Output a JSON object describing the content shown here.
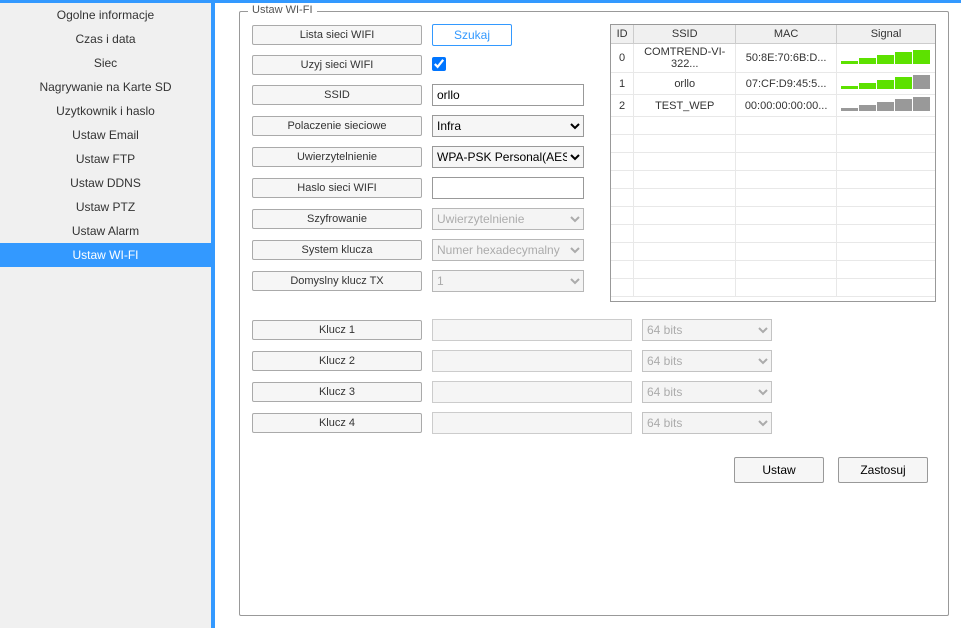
{
  "sidebar": {
    "items": [
      {
        "label": "Ogolne informacje"
      },
      {
        "label": "Czas i data"
      },
      {
        "label": "Siec"
      },
      {
        "label": "Nagrywanie na Karte SD"
      },
      {
        "label": "Uzytkownik i haslo"
      },
      {
        "label": "Ustaw Email"
      },
      {
        "label": "Ustaw FTP"
      },
      {
        "label": "Ustaw DDNS"
      },
      {
        "label": "Ustaw PTZ"
      },
      {
        "label": "Ustaw Alarm"
      },
      {
        "label": "Ustaw WI-FI"
      }
    ],
    "active_index": 10
  },
  "panel": {
    "title": "Ustaw WI-FI"
  },
  "form": {
    "lista_label": "Lista sieci WIFI",
    "szukaj_label": "Szukaj",
    "uzyj_label": "Uzyj sieci WIFI",
    "uzyj_checked": true,
    "ssid_label": "SSID",
    "ssid_value": "orllo",
    "polaczenie_label": "Polaczenie sieciowe",
    "polaczenie_value": "Infra",
    "uwierzytelnienie_label": "Uwierzytelnienie",
    "uwierzytelnienie_value": "WPA-PSK Personal(AES)",
    "haslo_label": "Haslo sieci WIFI",
    "haslo_value": "",
    "szyfrowanie_label": "Szyfrowanie",
    "szyfrowanie_value": "Uwierzytelnienie",
    "system_klucza_label": "System klucza",
    "system_klucza_value": "Numer hexadecymalny",
    "domyslny_klucz_label": "Domyslny klucz TX",
    "domyslny_klucz_value": "1",
    "keys": [
      {
        "label": "Klucz 1",
        "bits": "64 bits"
      },
      {
        "label": "Klucz 2",
        "bits": "64 bits"
      },
      {
        "label": "Klucz 3",
        "bits": "64 bits"
      },
      {
        "label": "Klucz 4",
        "bits": "64 bits"
      }
    ]
  },
  "table": {
    "headers": {
      "id": "ID",
      "ssid": "SSID",
      "mac": "MAC",
      "signal": "Signal"
    },
    "rows": [
      {
        "id": "0",
        "ssid": "COMTREND-VI-322...",
        "mac": "50:8E:70:6B:D...",
        "signal": 5
      },
      {
        "id": "1",
        "ssid": "orllo",
        "mac": "07:CF:D9:45:5...",
        "signal": 4
      },
      {
        "id": "2",
        "ssid": "TEST_WEP",
        "mac": "00:00:00:00:00...",
        "signal": 0
      }
    ]
  },
  "footer": {
    "ustaw": "Ustaw",
    "zastosuj": "Zastosuj"
  }
}
